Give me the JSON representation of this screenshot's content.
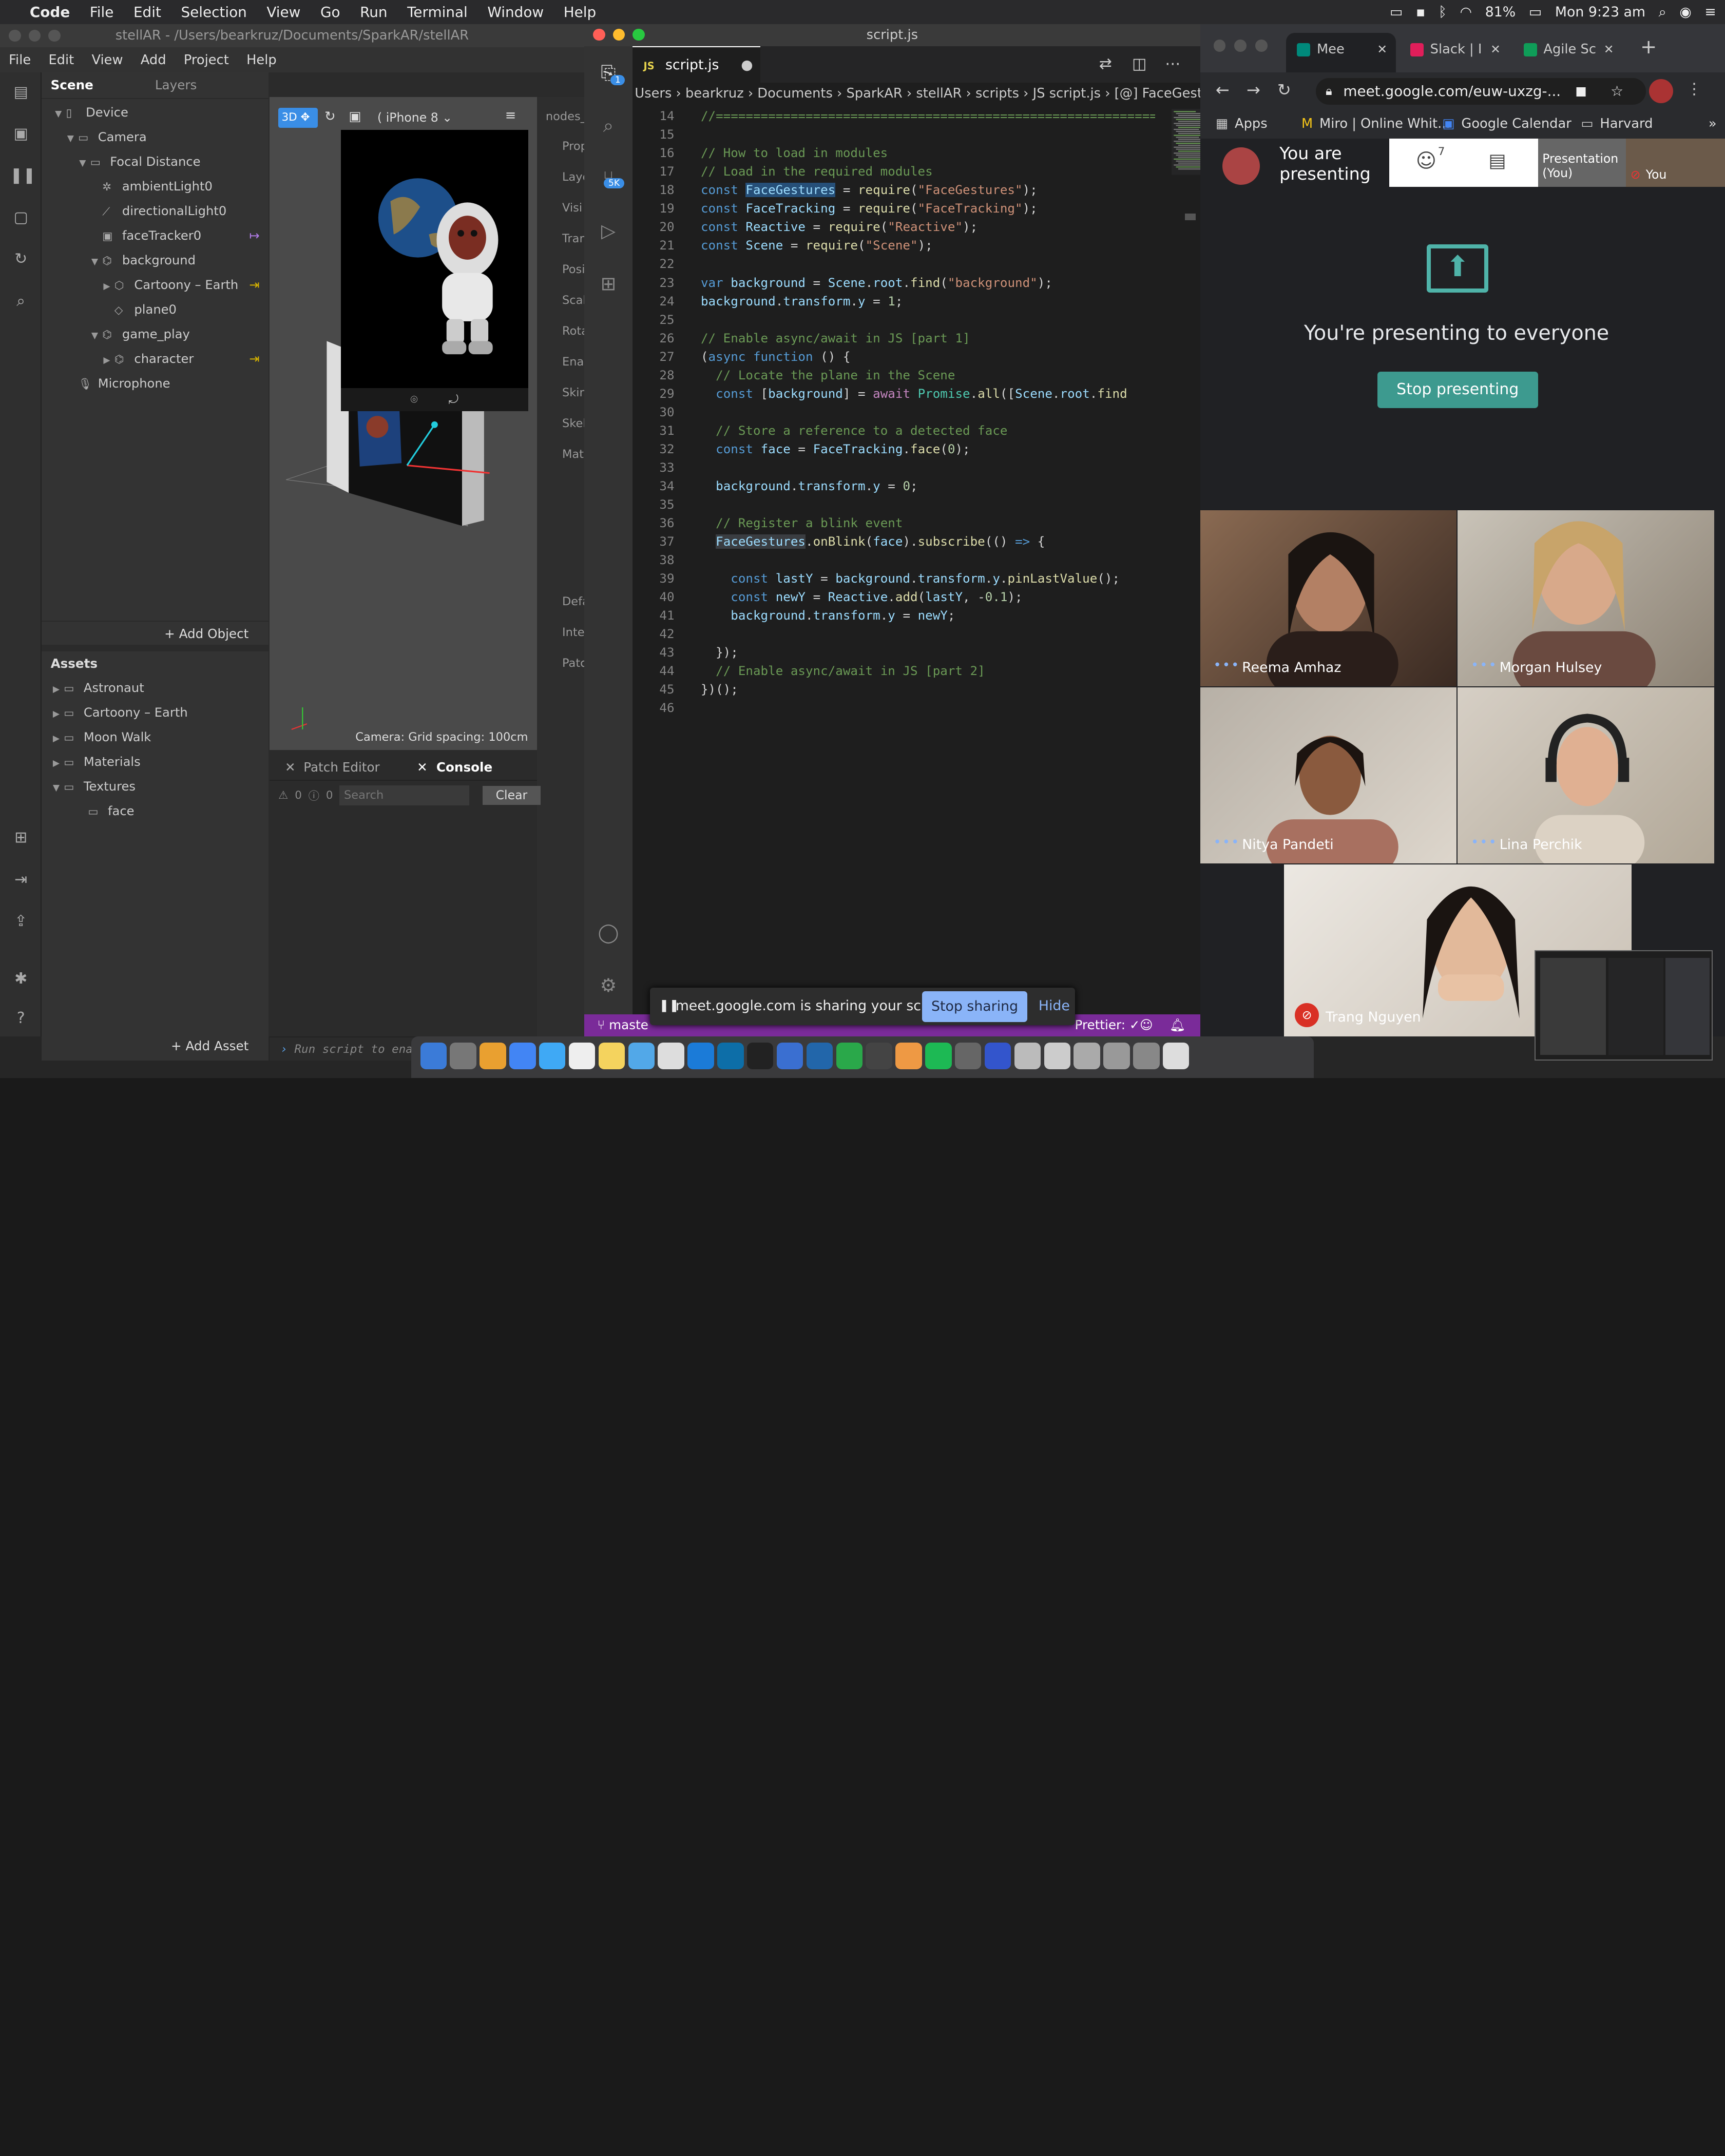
{
  "menubar": {
    "app": "Code",
    "items": [
      "File",
      "Edit",
      "Selection",
      "View",
      "Go",
      "Run",
      "Terminal",
      "Window",
      "Help"
    ],
    "battery": "81%",
    "clock": "Mon 9:23 am"
  },
  "spark": {
    "window_title": "stellAR - /Users/bearkruz/Documents/SparkAR/stellAR",
    "menu": [
      "File",
      "Edit",
      "View",
      "Add",
      "Project",
      "Help"
    ],
    "scene_tab": "Scene",
    "layers_tab": "Layers",
    "tree": [
      {
        "label": "Device",
        "indent": 0,
        "tri": "▼",
        "icon": "▯"
      },
      {
        "label": "Camera",
        "indent": 1,
        "tri": "▼",
        "icon": "▭"
      },
      {
        "label": "Focal Distance",
        "indent": 2,
        "tri": "▼",
        "icon": "▭"
      },
      {
        "label": "ambientLight0",
        "indent": 3,
        "tri": "",
        "icon": "✲"
      },
      {
        "label": "directionalLight0",
        "indent": 3,
        "tri": "",
        "icon": "⟋"
      },
      {
        "label": "faceTracker0",
        "indent": 3,
        "tri": "",
        "icon": "▣",
        "link": "↦"
      },
      {
        "label": "background",
        "indent": 3,
        "tri": "▼",
        "icon": "⌬"
      },
      {
        "label": "Cartoony – Earth",
        "indent": 4,
        "tri": "▶",
        "icon": "⬡",
        "link": "⇥"
      },
      {
        "label": "plane0",
        "indent": 4,
        "tri": "",
        "icon": "◇"
      },
      {
        "label": "game_play",
        "indent": 3,
        "tri": "▼",
        "icon": "⌬"
      },
      {
        "label": "character",
        "indent": 4,
        "tri": "▶",
        "icon": "⌬",
        "link": "⇥"
      },
      {
        "label": "Microphone",
        "indent": 1,
        "tri": "",
        "icon": "🎙"
      }
    ],
    "add_object": "Add Object",
    "assets_title": "Assets",
    "assets": [
      {
        "label": "Astronaut",
        "tri": "▶",
        "indent": 0
      },
      {
        "label": "Cartoony – Earth",
        "tri": "▶",
        "indent": 0
      },
      {
        "label": "Moon Walk",
        "tri": "▶",
        "indent": 0
      },
      {
        "label": "Materials",
        "tri": "▶",
        "indent": 0
      },
      {
        "label": "Textures",
        "tri": "▼",
        "indent": 0
      },
      {
        "label": "face",
        "tri": "",
        "indent": 1
      }
    ],
    "add_asset": "Add Asset",
    "viewport": {
      "mode": "3D",
      "device": "iPhone 8",
      "camera_label": "Camera: Grid spacing: 100cm"
    },
    "props": [
      "nodes_",
      "Prop",
      "Laye",
      "Visi",
      "Tran",
      "Posi",
      "Scal",
      "Rota",
      "Enal",
      "Skin",
      "Skel",
      "Mat",
      "Defa",
      "Inte",
      "Patc"
    ],
    "console": {
      "patch_tab": "Patch Editor",
      "console_tab": "Console",
      "warn_count": "0",
      "err_count": "0",
      "search_placeholder": "Search",
      "clear": "Clear",
      "hint": "Run script to enable command line."
    }
  },
  "vscode": {
    "title": "script.js",
    "tab": "script.js",
    "breadcrumbs": "Users › bearkruz › Documents › SparkAR › stellAR › scripts › JS script.js › [@] FaceGestures",
    "badge_explorer": "1",
    "badge_scm": "5K",
    "status_branch": "maste",
    "status_prettier": "Prettier: ✓",
    "lines": [
      {
        "n": "14",
        "html": "<span class='cm'>//===============================================================</span>"
      },
      {
        "n": "15",
        "html": ""
      },
      {
        "n": "16",
        "html": "<span class='cm'>// How to load in modules</span>"
      },
      {
        "n": "17",
        "html": "<span class='cm'>// Load in the required modules</span>"
      },
      {
        "n": "18",
        "html": "<span class='kw'>const</span> <span class='vr' style='background:#264f78'>FaceGestures</span> = <span class='fn'>require</span>(<span class='str'>\"FaceGestures\"</span>);"
      },
      {
        "n": "19",
        "html": "<span class='kw'>const</span> <span class='vr'>FaceTracking</span> = <span class='fn'>require</span>(<span class='str'>\"FaceTracking\"</span>);"
      },
      {
        "n": "20",
        "html": "<span class='kw'>const</span> <span class='vr'>Reactive</span> = <span class='fn'>require</span>(<span class='str'>\"Reactive\"</span>);"
      },
      {
        "n": "21",
        "html": "<span class='kw'>const</span> <span class='vr'>Scene</span> = <span class='fn'>require</span>(<span class='str'>\"Scene\"</span>);"
      },
      {
        "n": "22",
        "html": ""
      },
      {
        "n": "23",
        "html": "<span class='kw'>var</span> <span class='vr'>background</span> = <span class='vr'>Scene</span>.<span class='vr'>root</span>.<span class='fn'>find</span>(<span class='str'>\"background\"</span>);"
      },
      {
        "n": "24",
        "html": "<span class='vr'>background</span>.<span class='vr'>transform</span>.<span class='vr'>y</span> = <span class='num'>1</span>;"
      },
      {
        "n": "25",
        "html": ""
      },
      {
        "n": "26",
        "html": "<span class='cm'>// Enable async/await in JS [part 1]</span>"
      },
      {
        "n": "27",
        "html": "(<span class='kw'>async</span> <span class='kw'>function</span> () {"
      },
      {
        "n": "28",
        "html": "  <span class='cm'>// Locate the plane in the Scene</span>"
      },
      {
        "n": "29",
        "html": "  <span class='kw'>const</span> [<span class='vr'>background</span>] = <span class='kp'>await</span> <span class='cls'>Promise</span>.<span class='fn'>all</span>([<span class='vr'>Scene</span>.<span class='vr'>root</span>.<span class='fn'>find</span>"
      },
      {
        "n": "30",
        "html": ""
      },
      {
        "n": "31",
        "html": "  <span class='cm'>// Store a reference to a detected face</span>"
      },
      {
        "n": "32",
        "html": "  <span class='kw'>const</span> <span class='vr'>face</span> = <span class='vr'>FaceTracking</span>.<span class='fn'>face</span>(<span class='num'>0</span>);"
      },
      {
        "n": "33",
        "html": ""
      },
      {
        "n": "34",
        "html": "  <span class='vr'>background</span>.<span class='vr'>transform</span>.<span class='vr'>y</span> = <span class='num'>0</span>;"
      },
      {
        "n": "35",
        "html": ""
      },
      {
        "n": "36",
        "html": "  <span class='cm'>// Register a blink event</span>"
      },
      {
        "n": "37",
        "html": "  <span class='vr' style='background:#3a3d41'>FaceGestures</span>.<span class='fn'>onBlink</span>(<span class='vr'>face</span>).<span class='fn'>subscribe</span>(() <span class='kw'>=&gt;</span> {"
      },
      {
        "n": "38",
        "html": ""
      },
      {
        "n": "39",
        "html": "    <span class='kw'>const</span> <span class='vr'>lastY</span> = <span class='vr'>background</span>.<span class='vr'>transform</span>.<span class='vr'>y</span>.<span class='fn'>pinLastValue</span>();"
      },
      {
        "n": "40",
        "html": "    <span class='kw'>const</span> <span class='vr'>newY</span> = <span class='vr'>Reactive</span>.<span class='fn'>add</span>(<span class='vr'>lastY</span>, -<span class='num'>0.1</span>);"
      },
      {
        "n": "41",
        "html": "    <span class='vr'>background</span>.<span class='vr'>transform</span>.<span class='vr'>y</span> = <span class='vr'>newY</span>;"
      },
      {
        "n": "42",
        "html": ""
      },
      {
        "n": "43",
        "html": "  });"
      },
      {
        "n": "44",
        "html": "  <span class='cm'>// Enable async/await in JS [part 2]</span>"
      },
      {
        "n": "45",
        "html": "})();"
      },
      {
        "n": "46",
        "html": ""
      }
    ]
  },
  "sharebar": {
    "text": "meet.google.com is sharing your screen.",
    "stop": "Stop sharing",
    "hide": "Hide"
  },
  "chrome": {
    "tabs": [
      {
        "label": "Mee",
        "color": "#00897b"
      },
      {
        "label": "Slack | I",
        "color": "#e01e5a"
      },
      {
        "label": "Agile Sc",
        "color": "#0f9d58"
      }
    ],
    "url": "meet.google.com/euw-uxzg-...",
    "bookmarks": [
      "Apps",
      "Miro | Online Whit...",
      "Google Calendar",
      "Harvard"
    ],
    "presenting_label": "You are presenting",
    "people_count": "7",
    "presentation_you": "Presentation (You)",
    "you_label": "You",
    "banner": "You're presenting to everyone",
    "stop_presenting": "Stop presenting",
    "participants": [
      "Reema Amhaz",
      "Morgan Hulsey",
      "Nitya Pandeti",
      "Lina Perchik",
      "Trang Nguyen"
    ]
  },
  "colors": {
    "vscode_status": "#7a2b99",
    "meet_teal": "#3d9a8f",
    "accent_blue": "#3a8ee6"
  }
}
